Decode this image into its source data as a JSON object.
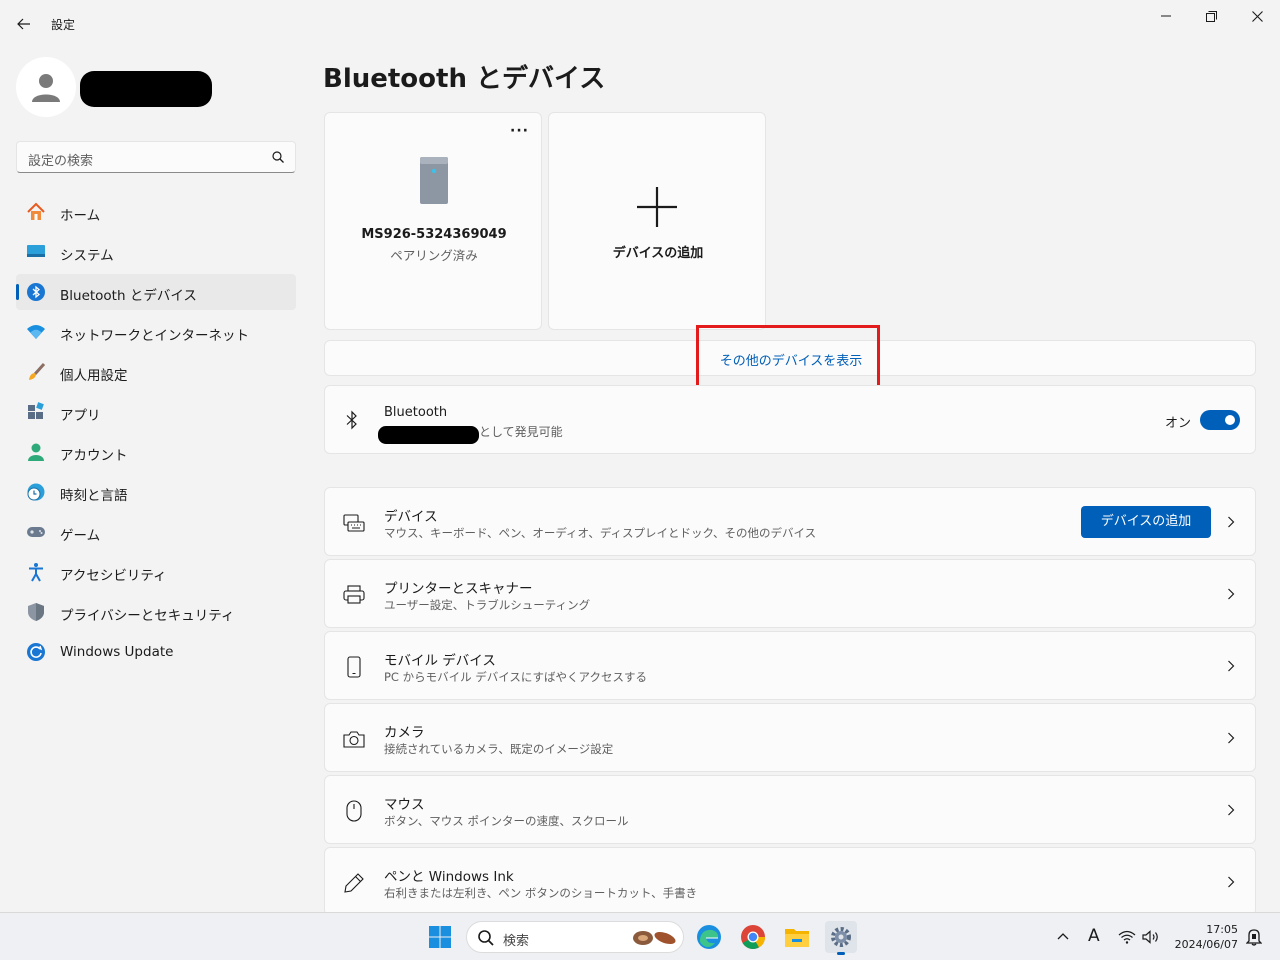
{
  "app": {
    "title": "設定"
  },
  "window": {
    "minimize": "minimize",
    "maximize": "restore",
    "close": "close"
  },
  "search": {
    "placeholder": "設定の検索"
  },
  "sidebar": {
    "items": [
      {
        "label": "ホーム",
        "icon": "home-icon"
      },
      {
        "label": "システム",
        "icon": "monitor-icon"
      },
      {
        "label": "Bluetooth とデバイス",
        "icon": "bluetooth-icon",
        "selected": true
      },
      {
        "label": "ネットワークとインターネット",
        "icon": "wifi-icon"
      },
      {
        "label": "個人用設定",
        "icon": "brush-icon"
      },
      {
        "label": "アプリ",
        "icon": "apps-icon"
      },
      {
        "label": "アカウント",
        "icon": "account-icon"
      },
      {
        "label": "時刻と言語",
        "icon": "clock-globe-icon"
      },
      {
        "label": "ゲーム",
        "icon": "gamepad-icon"
      },
      {
        "label": "アクセシビリティ",
        "icon": "accessibility-icon"
      },
      {
        "label": "プライバシーとセキュリティ",
        "icon": "shield-icon"
      },
      {
        "label": "Windows Update",
        "icon": "update-icon"
      }
    ]
  },
  "main": {
    "title": "Bluetooth とデバイス",
    "devices": [
      {
        "name": "MS926-5324369049",
        "status": "ペアリング済み"
      }
    ],
    "add_device_card": {
      "label": "デバイスの追加"
    },
    "more_devices_link": "その他のデバイスを表示",
    "bluetooth": {
      "title": "Bluetooth",
      "subtitle": "として発見可能",
      "state_label": "オン",
      "enabled": true
    },
    "categories": [
      {
        "title": "デバイス",
        "subtitle": "マウス、キーボード、ペン、オーディオ、ディスプレイとドック、その他のデバイス",
        "icon": "keyboard-icon",
        "button": "デバイスの追加"
      },
      {
        "title": "プリンターとスキャナー",
        "subtitle": "ユーザー設定、トラブルシューティング",
        "icon": "printer-icon"
      },
      {
        "title": "モバイル デバイス",
        "subtitle": "PC からモバイル デバイスにすばやくアクセスする",
        "icon": "phone-icon"
      },
      {
        "title": "カメラ",
        "subtitle": "接続されているカメラ、既定のイメージ設定",
        "icon": "camera-icon"
      },
      {
        "title": "マウス",
        "subtitle": "ボタン、マウス ポインターの速度、スクロール",
        "icon": "mouse-icon"
      },
      {
        "title": "ペンと Windows Ink",
        "subtitle": "右利きまたは左利き、ペン ボタンのショートカット、手書き",
        "icon": "pen-icon"
      }
    ]
  },
  "taskbar": {
    "search_placeholder": "検索",
    "ime": "A",
    "time": "17:05",
    "date": "2024/06/07"
  },
  "colors": {
    "accent": "#005fb8",
    "highlight": "#e31b1b",
    "background": "#f3f3f3",
    "card": "#fbfbfb"
  }
}
